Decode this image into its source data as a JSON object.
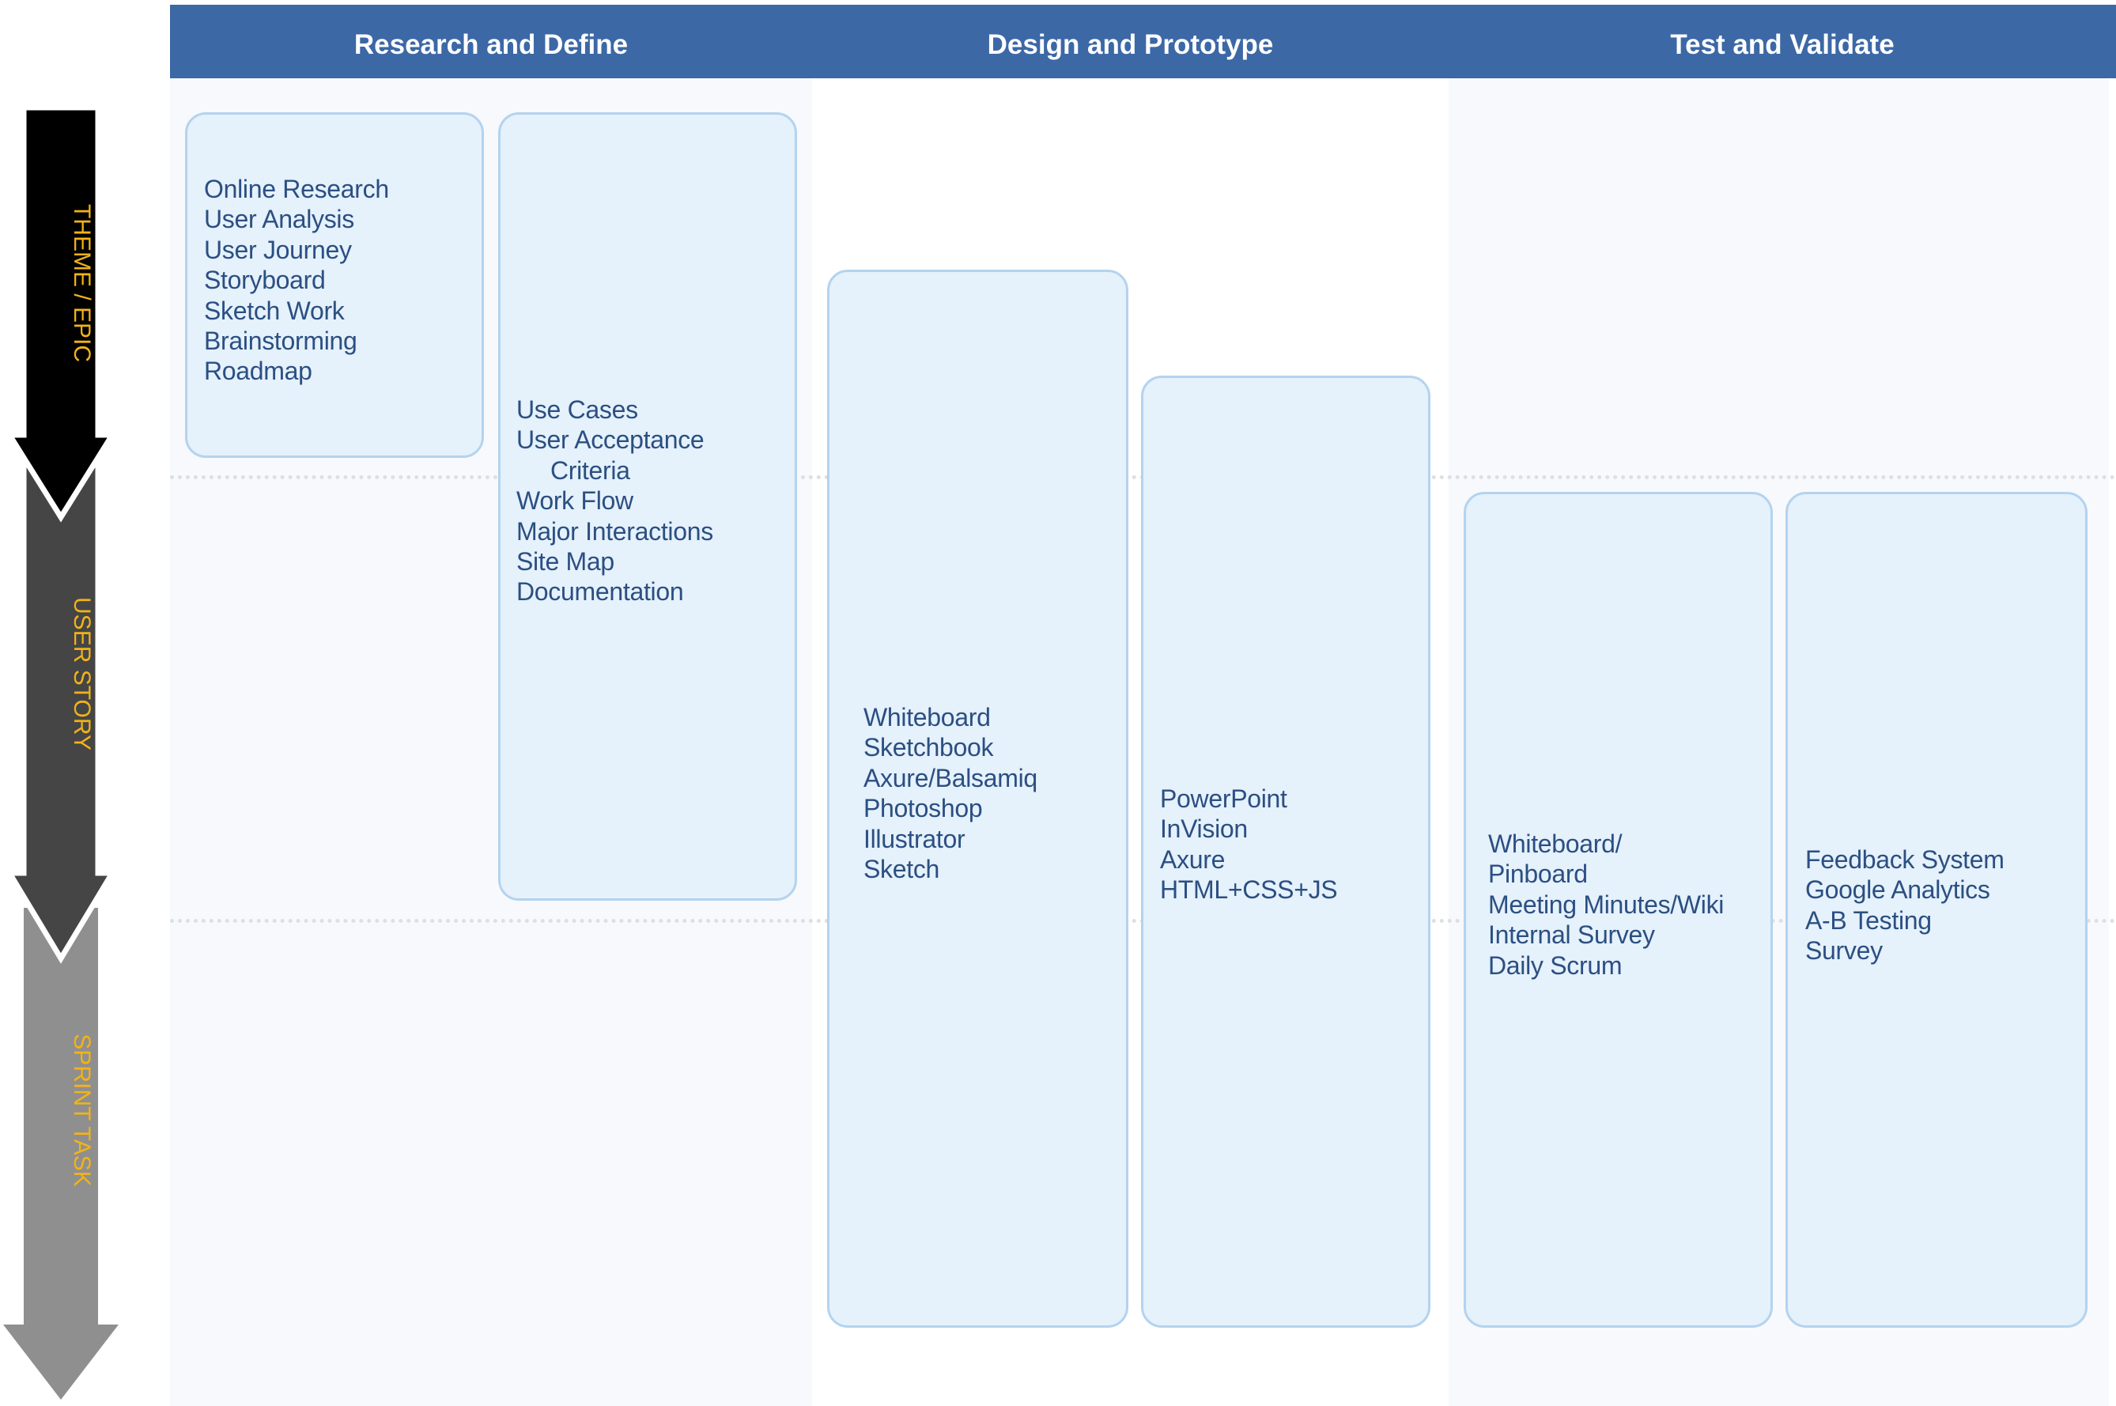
{
  "phases": [
    {
      "title": "Research and Define"
    },
    {
      "title": "Design and Prototype"
    },
    {
      "title": "Test and Validate"
    }
  ],
  "levels": [
    {
      "label": "THEME / EPIC",
      "color": "#000000"
    },
    {
      "label": "USER STORY",
      "color": "#454545"
    },
    {
      "label": "SPRINT TASK",
      "color": "#8f8f8f"
    }
  ],
  "cards": [
    {
      "lines": "Online Research\nUser Analysis\nUser Journey\nStoryboard\nSketch Work\nBrainstorming\nRoadmap"
    },
    {
      "lines": "Use Cases\nUser Acceptance\n     Criteria\nWork Flow\nMajor Interactions\nSite Map\nDocumentation"
    },
    {
      "lines": "Whiteboard\nSketchbook\nAxure/Balsamiq\nPhotoshop\nIllustrator\nSketch"
    },
    {
      "lines": "PowerPoint\nInVision\nAxure\nHTML+CSS+JS"
    },
    {
      "lines": "Whiteboard/\nPinboard\nMeeting Minutes/Wiki\nInternal Survey\nDaily Scrum"
    },
    {
      "lines": "Feedback System\nGoogle Analytics\nA-B Testing\nSurvey"
    }
  ],
  "colors": {
    "header": "#3c68a6",
    "card_fill": "#e5f1fb",
    "card_border": "#b4d3ee",
    "card_text": "#2b4f82",
    "level_text": "#f2b318"
  }
}
